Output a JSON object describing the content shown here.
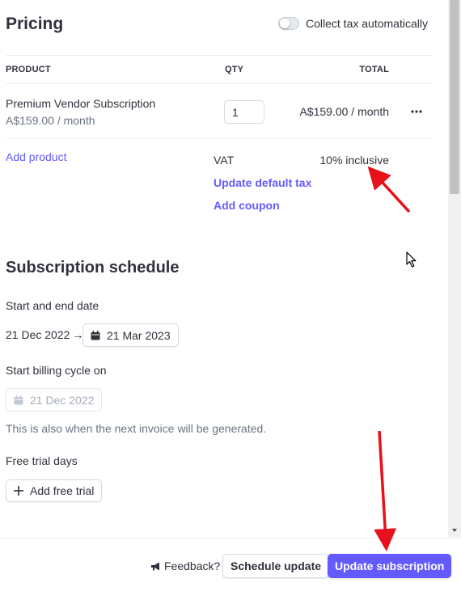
{
  "pricing": {
    "title": "Pricing",
    "collect_tax_label": "Collect tax automatically",
    "collect_tax_enabled": false,
    "columns": {
      "product": "PRODUCT",
      "qty": "QTY",
      "total": "TOTAL"
    },
    "line_items": [
      {
        "name": "Premium Vendor Subscription",
        "unit_price": "A$159.00 / month",
        "qty": "1",
        "total": "A$159.00 / month"
      }
    ],
    "add_product_label": "Add product",
    "tax": {
      "label": "VAT",
      "value": "10% inclusive"
    },
    "update_default_tax_label": "Update default tax",
    "add_coupon_label": "Add coupon"
  },
  "schedule": {
    "title": "Subscription schedule",
    "start_end_label": "Start and end date",
    "start_date": "21 Dec 2022",
    "arrow": "→",
    "end_date": "21 Mar 2023",
    "billing_cycle_label": "Start billing cycle on",
    "billing_cycle_date": "21 Dec 2022",
    "billing_helper": "This is also when the next invoice will be generated.",
    "free_trial_label": "Free trial days",
    "add_free_trial_label": "Add free trial"
  },
  "footer": {
    "feedback_label": "Feedback?",
    "schedule_update_label": "Schedule update",
    "update_subscription_label": "Update subscription"
  },
  "colors": {
    "accent": "#635bff",
    "text": "#30313d",
    "muted": "#6a7383",
    "annotation_arrow": "#e8101a"
  }
}
